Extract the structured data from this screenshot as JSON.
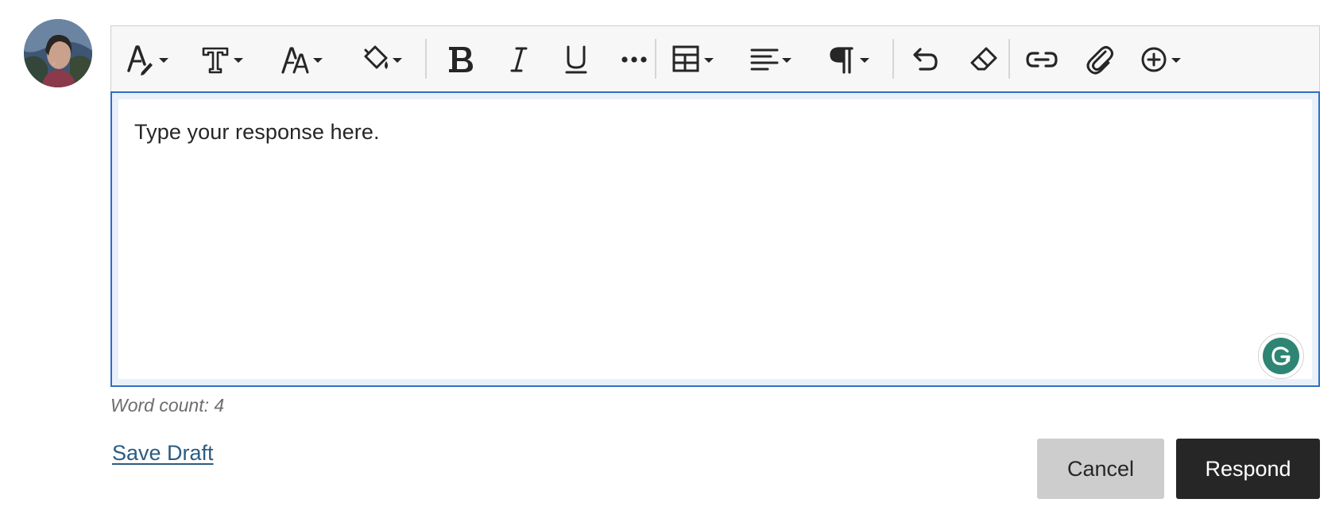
{
  "editor": {
    "content_text": "Type your response here.",
    "toolbar": [
      {
        "name": "text-style-icon",
        "has_dropdown": true
      },
      {
        "name": "text-format-icon",
        "has_dropdown": true
      },
      {
        "name": "font-size-icon",
        "has_dropdown": true
      },
      {
        "name": "highlight-color-icon",
        "has_dropdown": true
      },
      {
        "name": "bold-icon",
        "has_dropdown": false
      },
      {
        "name": "italic-icon",
        "has_dropdown": false
      },
      {
        "name": "underline-icon",
        "has_dropdown": false
      },
      {
        "name": "more-options-icon",
        "has_dropdown": false
      },
      {
        "name": "table-icon",
        "has_dropdown": true
      },
      {
        "name": "align-left-icon",
        "has_dropdown": true
      },
      {
        "name": "paragraph-icon",
        "has_dropdown": true
      },
      {
        "name": "undo-icon",
        "has_dropdown": false
      },
      {
        "name": "clear-format-icon",
        "has_dropdown": false
      },
      {
        "name": "link-icon",
        "has_dropdown": false
      },
      {
        "name": "attachment-icon",
        "has_dropdown": false
      },
      {
        "name": "insert-content-icon",
        "has_dropdown": true
      }
    ]
  },
  "footer": {
    "word_count": "Word count: 4",
    "save_draft": "Save Draft",
    "cancel": "Cancel",
    "respond": "Respond"
  },
  "colors": {
    "focus_border": "#2f6ec2",
    "primary_button": "#262626",
    "secondary_button": "#cdcdcd",
    "link": "#2b5c82",
    "grammarly": "#2e8573"
  }
}
